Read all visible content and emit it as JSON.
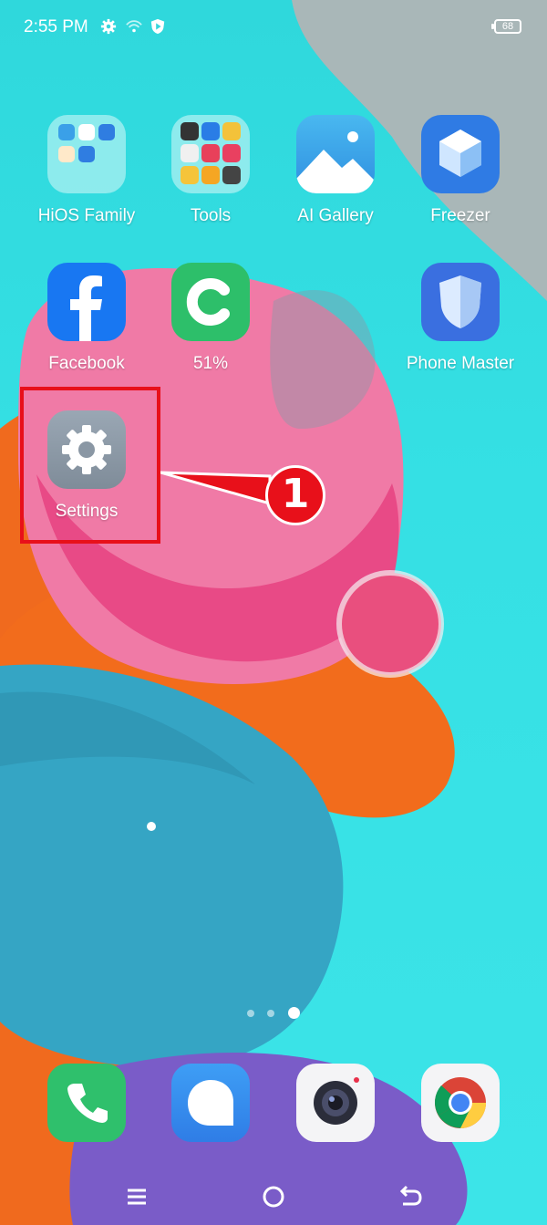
{
  "status_bar": {
    "time": "2:55 PM",
    "battery": "68",
    "icons": [
      "gear-icon",
      "wifi-icon",
      "shield-icon"
    ]
  },
  "apps": [
    {
      "label": "HiOS Family",
      "icon": "hios-family-folder-icon"
    },
    {
      "label": "Tools",
      "icon": "tools-folder-icon"
    },
    {
      "label": "AI Gallery",
      "icon": "gallery-icon"
    },
    {
      "label": "Freezer",
      "icon": "freezer-cube-icon"
    },
    {
      "label": "Facebook",
      "icon": "facebook-icon"
    },
    {
      "label": "51%",
      "icon": "cleaner-c-icon"
    },
    {
      "label": "Phone Master",
      "icon": "phone-master-shield-icon"
    },
    {
      "label": "Settings",
      "icon": "settings-gear-icon"
    }
  ],
  "annotation": {
    "step": "1",
    "color": "#e8101a"
  },
  "page_indicator": {
    "pages": 3,
    "current": 3
  },
  "dock": [
    {
      "name": "phone",
      "icon": "phone-icon"
    },
    {
      "name": "messages",
      "icon": "message-bubble-icon"
    },
    {
      "name": "camera",
      "icon": "camera-icon"
    },
    {
      "name": "chrome",
      "icon": "chrome-icon"
    }
  ],
  "nav_bar": {
    "icons": [
      "menu-icon",
      "home-icon",
      "back-icon"
    ]
  }
}
